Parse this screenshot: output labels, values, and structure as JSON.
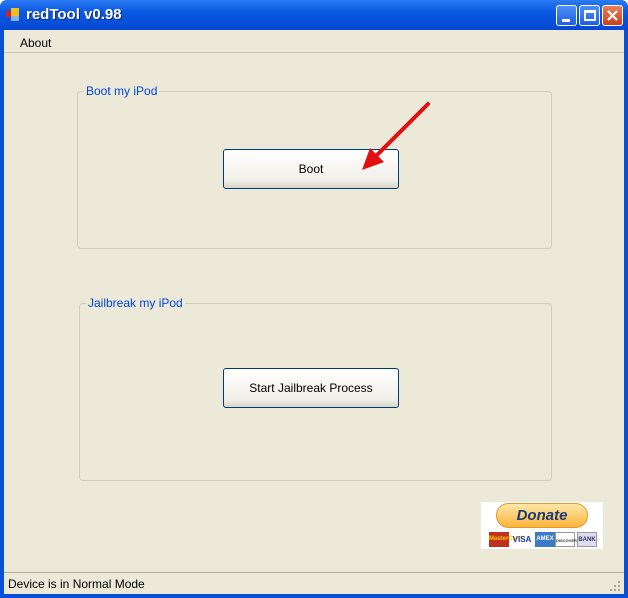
{
  "window": {
    "title": "redTool v0.98"
  },
  "menu": {
    "items": [
      {
        "label": "About"
      }
    ]
  },
  "boot_group": {
    "label": "Boot my iPod",
    "button": "Boot"
  },
  "jailbreak_group": {
    "label": "Jailbreak my iPod",
    "button": "Start Jailbreak Process"
  },
  "donate": {
    "label": "Donate",
    "cards": [
      "MasterCard",
      "VISA",
      "AMEX",
      "DISCOVER",
      "BANK"
    ]
  },
  "status": {
    "text": "Device is in Normal Mode"
  },
  "colors": {
    "titlebar": "#0648d4",
    "group_label": "#0046d5",
    "arrow": "#e01010",
    "face": "#ece9d8"
  }
}
